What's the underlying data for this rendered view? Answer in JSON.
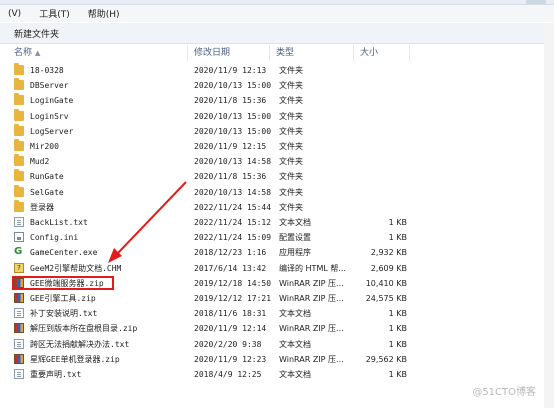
{
  "menu": [
    "工具(T)",
    "帮助(H)"
  ],
  "menu_left": "(V)",
  "toolbar": {
    "new_folder": "新建文件夹"
  },
  "columns": {
    "name": "名称",
    "date": "修改日期",
    "type": "类型",
    "size": "大小"
  },
  "rows": [
    {
      "name": "18-0328",
      "date": "2020/11/9 12:13",
      "type": "文件夹",
      "size": "",
      "icon": "folder-icon"
    },
    {
      "name": "DBServer",
      "date": "2020/10/13 15:00",
      "type": "文件夹",
      "size": "",
      "icon": "folder-icon"
    },
    {
      "name": "LoginGate",
      "date": "2020/11/8 15:36",
      "type": "文件夹",
      "size": "",
      "icon": "folder-icon"
    },
    {
      "name": "LoginSrv",
      "date": "2020/10/13 15:00",
      "type": "文件夹",
      "size": "",
      "icon": "folder-icon"
    },
    {
      "name": "LogServer",
      "date": "2020/10/13 15:00",
      "type": "文件夹",
      "size": "",
      "icon": "folder-icon"
    },
    {
      "name": "Mir200",
      "date": "2020/11/9 12:15",
      "type": "文件夹",
      "size": "",
      "icon": "folder-icon"
    },
    {
      "name": "Mud2",
      "date": "2020/10/13 14:58",
      "type": "文件夹",
      "size": "",
      "icon": "folder-icon"
    },
    {
      "name": "RunGate",
      "date": "2020/11/8 15:36",
      "type": "文件夹",
      "size": "",
      "icon": "folder-icon"
    },
    {
      "name": "SelGate",
      "date": "2020/10/13 14:58",
      "type": "文件夹",
      "size": "",
      "icon": "folder-icon"
    },
    {
      "name": "登录器",
      "date": "2022/11/24 15:44",
      "type": "文件夹",
      "size": "",
      "icon": "folder-icon"
    },
    {
      "name": "BackList.txt",
      "date": "2022/11/24 15:12",
      "type": "文本文档",
      "size": "1 KB",
      "icon": "text-file-icon"
    },
    {
      "name": "Config.ini",
      "date": "2022/11/24 15:09",
      "type": "配置设置",
      "size": "1 KB",
      "icon": "ini-file-icon"
    },
    {
      "name": "GameCenter.exe",
      "date": "2018/12/23 1:16",
      "type": "应用程序",
      "size": "2,932 KB",
      "icon": "exe-icon"
    },
    {
      "name": "GeeM2引擎帮助文档.CHM",
      "date": "2017/6/14 13:42",
      "type": "编译的 HTML 帮...",
      "size": "2,609 KB",
      "icon": "chm-icon"
    },
    {
      "name": "GEE微端服务器.zip",
      "date": "2019/12/18 14:50",
      "type": "WinRAR ZIP 压...",
      "size": "10,410 KB",
      "icon": "zip-icon",
      "highlight": true
    },
    {
      "name": "GEE引擎工具.zip",
      "date": "2019/12/12 17:21",
      "type": "WinRAR ZIP 压...",
      "size": "24,575 KB",
      "icon": "zip-icon"
    },
    {
      "name": "补丁安装说明.txt",
      "date": "2018/11/6 18:31",
      "type": "文本文档",
      "size": "1 KB",
      "icon": "text-file-icon"
    },
    {
      "name": "解压到版本所在盘根目录.zip",
      "date": "2020/11/9 12:14",
      "type": "WinRAR ZIP 压...",
      "size": "1 KB",
      "icon": "zip-icon"
    },
    {
      "name": "跨区无法捐献解决办法.txt",
      "date": "2020/2/20 9:38",
      "type": "文本文档",
      "size": "1 KB",
      "icon": "text-file-icon"
    },
    {
      "name": "星辉GEE单机登录器.zip",
      "date": "2020/11/9 12:23",
      "type": "WinRAR ZIP 压...",
      "size": "29,562 KB",
      "icon": "zip-icon"
    },
    {
      "name": "重要声明.txt",
      "date": "2018/4/9 12:25",
      "type": "文本文档",
      "size": "1 KB",
      "icon": "text-file-icon"
    }
  ],
  "watermark": "@51CTO博客",
  "annotation_color": "#e21b1b"
}
